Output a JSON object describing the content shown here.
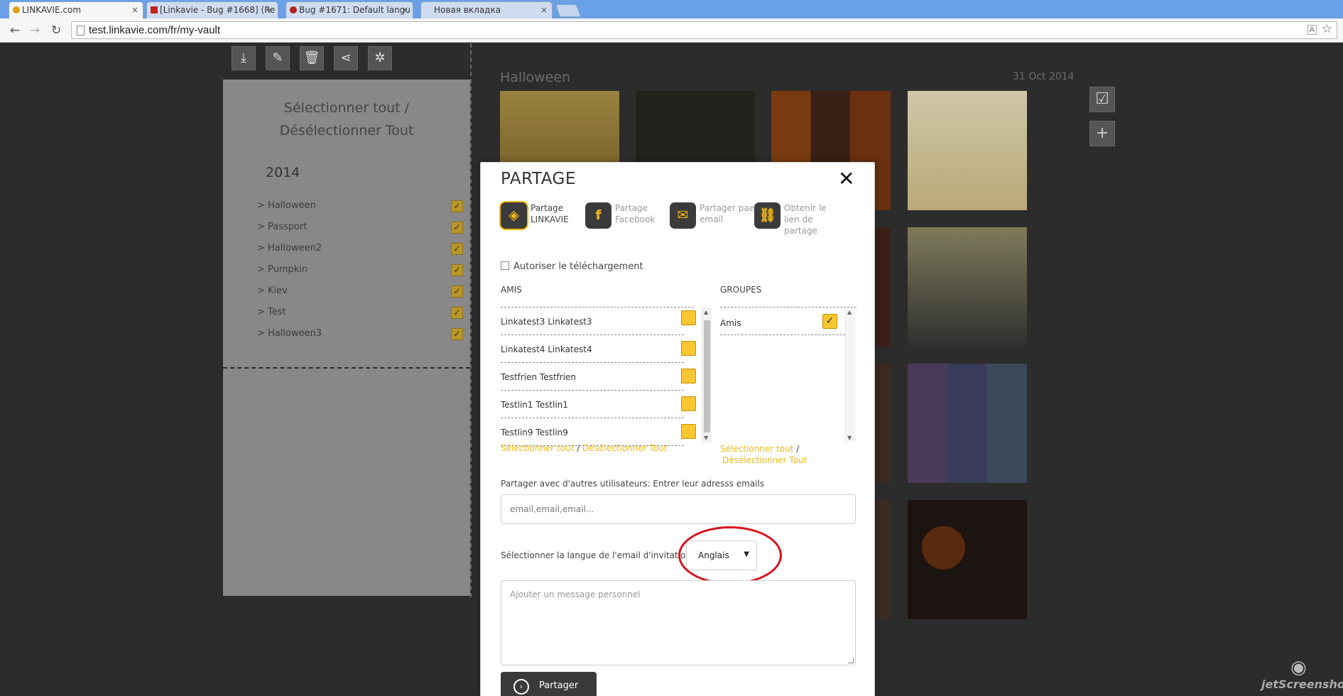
{
  "browser": {
    "tabs": [
      {
        "title": "LINKAVIE.com",
        "favicon": "linkavie-favicon",
        "color": "#e0a010"
      },
      {
        "title": "[Linkavie - Bug #1668] (Re",
        "favicon": "gmail-favicon",
        "color": "#c5221f"
      },
      {
        "title": "Bug #1671: Default langu",
        "favicon": "redmine-favicon",
        "color": "#b02020"
      },
      {
        "title": "Новая вкладка",
        "favicon": "",
        "color": "#cfdcef"
      }
    ],
    "url": "test.linkavie.com/fr/my-vault",
    "tab_close": "×"
  },
  "toolbar_icons": [
    "download-icon",
    "edit-icon",
    "trash-icon",
    "share-icon",
    "settings-icon"
  ],
  "sidebar": {
    "select_all": "Sélectionner tout / Désélectionner Tout",
    "year": "2014",
    "albums": [
      {
        "label": "> Halloween",
        "checked": true
      },
      {
        "label": "> Passport",
        "checked": true
      },
      {
        "label": "> Halloween2",
        "checked": true
      },
      {
        "label": "> Pumpkin",
        "checked": true
      },
      {
        "label": "> Kiev",
        "checked": true
      },
      {
        "label": "> Test",
        "checked": true
      },
      {
        "label": "> Halloween3",
        "checked": true
      }
    ]
  },
  "album": {
    "title": "Halloween",
    "date": "31 Oct 2014"
  },
  "modal": {
    "title": "PARTAGE",
    "close": "✕",
    "share_options": [
      {
        "label": "Partage LINKAVIE",
        "icon": "linkavie-logo-icon",
        "glyph": "◈",
        "active": true
      },
      {
        "label": "Partage Facebook",
        "icon": "facebook-icon",
        "glyph": "f",
        "active": false
      },
      {
        "label": "Partager pae email",
        "icon": "email-envelope-icon",
        "glyph": "✉",
        "active": false
      },
      {
        "label": "Obtenir le lien de partage",
        "icon": "link-chain-icon",
        "glyph": "⛓",
        "active": false
      }
    ],
    "allow_download": "Autoriser le téléchargement",
    "friends_header": "AMIS",
    "groups_header": "GROUPES",
    "friends": [
      {
        "name": "Linkatest3 Linkatest3",
        "checked": false
      },
      {
        "name": "Linkatest4 Linkatest4",
        "checked": false
      },
      {
        "name": "Testfrien Testfrien",
        "checked": false
      },
      {
        "name": "Testlin1 Testlin1",
        "checked": false
      },
      {
        "name": "Testlin9 Testlin9",
        "checked": false
      }
    ],
    "groups": [
      {
        "name": "Amis",
        "checked": true
      }
    ],
    "select_all": "Sélectionner tout",
    "deselect_all": "Désélectionner Tout",
    "slash": "/",
    "other_users_label": "Partager avec d'autres utilisateurs: Entrer leur adresss emails",
    "email_placeholder": "email,email,email...",
    "language_label": "Sélectionner la langue de l'email d'invitation",
    "language_value": "Anglais",
    "message_placeholder": "Ajouter un message personnel",
    "share_button": "Partager"
  },
  "watermark": "jetScreenshot",
  "colors": {
    "accent": "#f2b90f",
    "checkbox": "#f7c631",
    "annotation": "#d9111b"
  }
}
